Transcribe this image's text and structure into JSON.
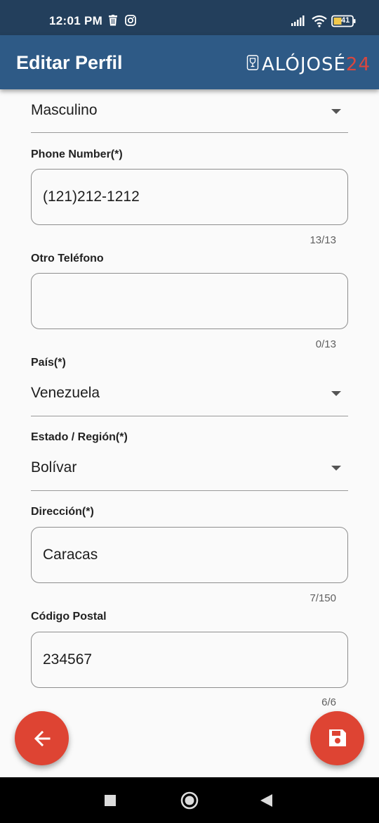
{
  "status_bar": {
    "time": "12:01 PM",
    "left_icons": [
      "trash-icon",
      "instagram-icon"
    ],
    "right_icons": [
      "signal-icon",
      "wifi-icon",
      "battery-icon"
    ],
    "battery_level": "41"
  },
  "app_bar": {
    "title": "Editar Perfil",
    "brand_text": "ALÓJOSÉ",
    "brand_number": "24",
    "colors": {
      "background": "#2e5a86",
      "status": "#233f5c"
    }
  },
  "form": {
    "gender": {
      "value": "Masculino"
    },
    "phone": {
      "label": "Phone Number(*)",
      "value": "(121)212-1212",
      "counter": "13/13"
    },
    "other_phone": {
      "label": "Otro Teléfono",
      "value": "",
      "counter": "0/13"
    },
    "country": {
      "label": "País(*)",
      "value": "Venezuela"
    },
    "state": {
      "label": "Estado / Región(*)",
      "value": "Bolívar"
    },
    "address": {
      "label": "Dirección(*)",
      "value": "Caracas",
      "counter": "7/150"
    },
    "postal": {
      "label": "Código Postal",
      "value": "234567",
      "counter": "6/6"
    }
  },
  "actions": {
    "back_icon": "arrow-left-icon",
    "save_icon": "save-icon",
    "accent_color": "#de4433"
  },
  "nav_bar": {
    "icons": [
      "recents-square-icon",
      "home-circle-icon",
      "back-triangle-icon"
    ]
  }
}
